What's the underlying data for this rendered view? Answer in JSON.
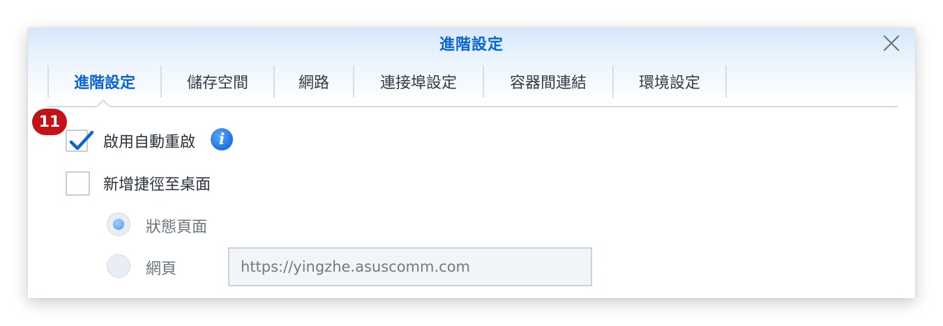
{
  "dialog": {
    "title": "進階設定",
    "close_icon": "close-x-icon"
  },
  "tabs": [
    {
      "label": "進階設定",
      "active": true
    },
    {
      "label": "儲存空間",
      "active": false
    },
    {
      "label": "網路",
      "active": false
    },
    {
      "label": "連接埠設定",
      "active": false
    },
    {
      "label": "容器間連結",
      "active": false
    },
    {
      "label": "環境設定",
      "active": false
    }
  ],
  "badge": {
    "text": "11",
    "color": "#c4121a"
  },
  "options": {
    "auto_restart": {
      "label": "啟用自動重啟",
      "checked": true,
      "info_icon": "info-icon",
      "info_glyph": "i"
    },
    "desktop_shortcut": {
      "label": "新增捷徑至桌面",
      "checked": false
    }
  },
  "shortcut_target": {
    "status_page": {
      "label": "狀態頁面",
      "selected": true
    },
    "web_page": {
      "label": "網頁",
      "selected": false,
      "url_value": "https://yingzhe.asuscomm.com"
    }
  },
  "colors": {
    "accent": "#0b64d6",
    "check": "#0b64d6",
    "badge": "#c4121a"
  }
}
